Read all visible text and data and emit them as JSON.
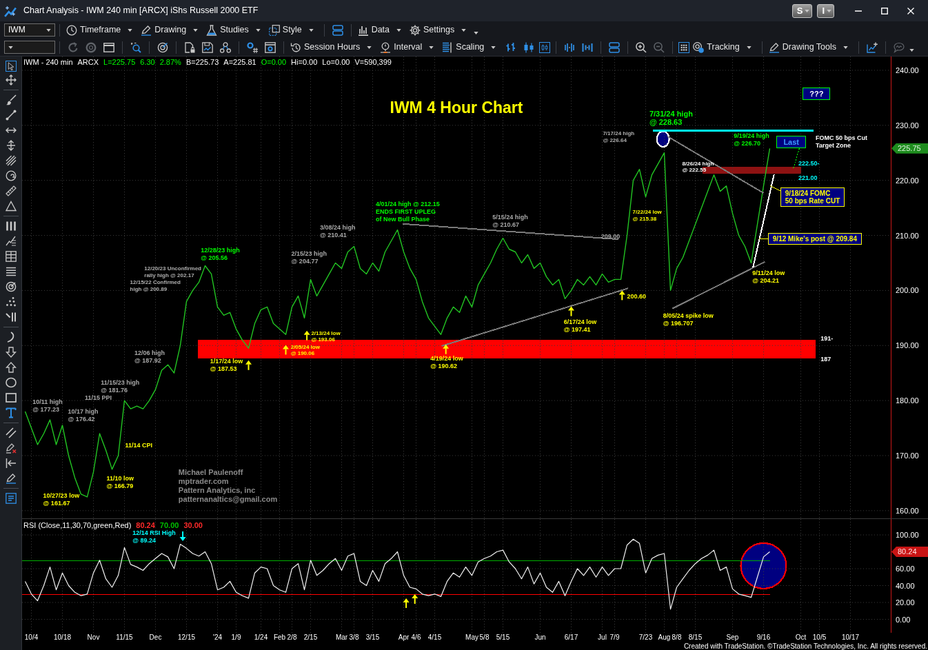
{
  "window": {
    "title": "Chart Analysis - IWM 240 min [ARCX] iShs Russell 2000 ETF",
    "account_buttons": [
      "S",
      "I"
    ]
  },
  "toolbar_1": {
    "symbol": "IWM",
    "menus": [
      "Timeframe",
      "Drawing",
      "Studies",
      "Style",
      "Data",
      "Settings"
    ]
  },
  "toolbar_2": {
    "menus": [
      "Session Hours",
      "Interval",
      "Scaling",
      "Tracking",
      "Drawing Tools"
    ],
    "bar_types": [
      {
        "selected": false
      },
      {
        "selected": false
      },
      {
        "selected": true
      }
    ],
    "grid": {
      "on": true
    }
  },
  "tool_palette": [
    {
      "selected": true
    },
    {
      "selected": false
    },
    {
      "selected": false
    },
    {
      "selected": false
    },
    {
      "selected": false
    },
    {
      "selected": false
    },
    {
      "selected": false
    },
    {
      "selected": false
    },
    {
      "selected": false
    },
    {
      "selected": false
    },
    {
      "selected": false
    },
    {
      "selected": false
    },
    {
      "selected": false
    },
    {
      "selected": false
    },
    {
      "selected": false
    },
    {
      "selected": false
    },
    {
      "selected": false
    },
    {
      "selected": false
    },
    {
      "selected": false
    },
    {
      "selected": false
    },
    {
      "selected": false
    },
    {
      "selected": false
    },
    {
      "selected": false
    },
    {
      "selected": false
    },
    {
      "selected": false
    },
    {
      "selected": false
    },
    {
      "selected": false
    },
    {
      "selected": false
    }
  ],
  "price_panel": {
    "info": [
      {
        "text": "IWM - 240 min",
        "color": "#ffffff"
      },
      {
        "text": "ARCX",
        "color": "#ffffff"
      },
      {
        "text": "L=225.75",
        "color": "#00ff00"
      },
      {
        "text": "6.30",
        "color": "#00ff00"
      },
      {
        "text": "2.87%",
        "color": "#00ff00"
      },
      {
        "text": "B=225.73",
        "color": "#ffffff"
      },
      {
        "text": "A=225.81",
        "color": "#ffffff"
      },
      {
        "text": "O=0.00",
        "color": "#00ff00"
      },
      {
        "text": "Hi=0.00",
        "color": "#ffffff"
      },
      {
        "text": "Lo=0.00",
        "color": "#ffffff"
      },
      {
        "text": "V=590,399",
        "color": "#ffffff"
      }
    ],
    "last_marker": "225.75",
    "chart_data": {
      "type": "line",
      "title": "IWM 4 Hour Chart",
      "grid": true,
      "ylim": [
        158.6,
        242.5
      ],
      "yticks": [
        {
          "value": 160,
          "label": "160.00"
        },
        {
          "value": 170,
          "label": "170.00"
        },
        {
          "value": 180,
          "label": "180.00"
        },
        {
          "value": 190,
          "label": "190.00"
        },
        {
          "value": 200,
          "label": "200.00"
        },
        {
          "value": 210,
          "label": "210.00"
        },
        {
          "value": 220,
          "label": "220.00"
        },
        {
          "value": 230,
          "label": "230.00"
        },
        {
          "value": 240,
          "label": "240.00"
        }
      ],
      "values": [
        178,
        175,
        172,
        174,
        176.5,
        172,
        175.5,
        170,
        166,
        163,
        162.5,
        167,
        174,
        171,
        167.5,
        170,
        180,
        178.5,
        179,
        178.5,
        180,
        182,
        185.5,
        186.5,
        185,
        190,
        198,
        200,
        201.5,
        204.5,
        203,
        197,
        195.5,
        196,
        193,
        191,
        189.5,
        194,
        196.5,
        197,
        194,
        193,
        192,
        197,
        199,
        195,
        202,
        199,
        201,
        203,
        205,
        204,
        207,
        208,
        204,
        203,
        205,
        203.5,
        207,
        209,
        211,
        207,
        204,
        202,
        198,
        195,
        193.5,
        192,
        195,
        197,
        196,
        199,
        197,
        201,
        203,
        205,
        207.5,
        209.5,
        207.5,
        207,
        205,
        206.5,
        204,
        205,
        202.5,
        201,
        202,
        198.5,
        200,
        202,
        201,
        202.5,
        201,
        203,
        201.5,
        202,
        202,
        210,
        220,
        222,
        217,
        221,
        223,
        225,
        200,
        204,
        206,
        209,
        212,
        215,
        218,
        221,
        218,
        219,
        214,
        210,
        208,
        205,
        212,
        219,
        225.8,
        null,
        null,
        null,
        null,
        null,
        null,
        null,
        null,
        null,
        null,
        null,
        null,
        null,
        null,
        null,
        null,
        null,
        null,
        null
      ]
    },
    "drawings": [
      {
        "kind": "band",
        "color": "#ff0000"
      },
      {
        "kind": "band",
        "color": "#8e1212"
      },
      {
        "kind": "thick_line",
        "color": "#00ffff"
      },
      {
        "kind": "ellipse",
        "color": "#ffffff"
      },
      {
        "kind": "line",
        "color": "#7a7a7a"
      },
      {
        "kind": "line",
        "color": "#7a7a7a"
      },
      {
        "kind": "line",
        "color": "#7a7a7a"
      },
      {
        "kind": "line",
        "color": "#7a7a7a"
      },
      {
        "kind": "line",
        "color": "#ffffff"
      },
      {
        "kind": "dotted_line",
        "color": "#00ff00"
      },
      {
        "kind": "leader_line",
        "color": "#ffff00"
      },
      {
        "kind": "leader_line",
        "color": "#ffff00"
      },
      {
        "kind": "up_arrow",
        "color": "#ffff00"
      },
      {
        "kind": "up_arrow",
        "color": "#ffff00"
      },
      {
        "kind": "up_arrow",
        "color": "#ffff00"
      },
      {
        "kind": "up_arrow",
        "color": "#ffff00"
      },
      {
        "kind": "up_arrow",
        "color": "#ffff00"
      },
      {
        "kind": "up_arrow",
        "color": "#ffff00"
      }
    ],
    "notes": [
      {
        "kind": "tag",
        "text": "???",
        "color": "#ffffff"
      },
      {
        "kind": "large_text",
        "text": "7/31/24 high\n@ 228.63",
        "color": "#00ff00"
      },
      {
        "kind": "small_text",
        "text": "7/17/24 high\n@ 226.64",
        "color": "#b0b0b0"
      },
      {
        "kind": "text",
        "text": "9/19/24 high\n@ 226.70",
        "color": "#00ff00"
      },
      {
        "kind": "tag",
        "text": "Last",
        "color": "#3d9bff"
      },
      {
        "kind": "text",
        "text": "FOMC 50 bps Cut\nTarget Zone",
        "color": "#ffffff"
      },
      {
        "kind": "small_text",
        "text": "8/26/24 high\n@ 222.55",
        "color": "#ffffff"
      },
      {
        "kind": "text",
        "text": "222.50-",
        "color": "#00ffff"
      },
      {
        "kind": "text",
        "text": "221.00",
        "color": "#00ffff"
      },
      {
        "kind": "callout",
        "text": "9/18/24 FOMC\n50 bps Rate CUT",
        "color": "#ffff00"
      },
      {
        "kind": "text",
        "text": "4/01/24 high @ 212.15\nENDS FIRST UPLEG\nof New Bull Phase",
        "color": "#00ff00"
      },
      {
        "kind": "small_text",
        "text": "7/22/24 low\n@ 215.38",
        "color": "#ffff00"
      },
      {
        "kind": "text",
        "text": "5/15/24 high\n@ 210.67",
        "color": "#a8a8a8"
      },
      {
        "kind": "text",
        "text": "3/08/24 high\n@ 210.41",
        "color": "#a8a8a8"
      },
      {
        "kind": "text",
        "text": "209.00",
        "color": "#a8a8a8"
      },
      {
        "kind": "callout",
        "text": "9/12 Mike's post @ 209.84",
        "color": "#ffff00"
      },
      {
        "kind": "text",
        "text": "12/28/23 high\n@ 205.56",
        "color": "#00ff00"
      },
      {
        "kind": "text",
        "text": "2/15/23 high\n@ 204.77",
        "color": "#a8a8a8"
      },
      {
        "kind": "small_text",
        "text": "12/20/23 Unconfirmed\nrally high @ 202.17",
        "color": "#b0b0b0"
      },
      {
        "kind": "text",
        "text": "9/11/24 low\n@ 204.21",
        "color": "#ffff00"
      },
      {
        "kind": "small_text",
        "text": "12/15/22 Confirmed\nhigh @ 200.89",
        "color": "#b0b0b0"
      },
      {
        "kind": "text",
        "text": "200.60",
        "color": "#ffff00"
      },
      {
        "kind": "text",
        "text": "8/05/24 spike low\n@ 196.707",
        "color": "#ffff00"
      },
      {
        "kind": "text",
        "text": "6/17/24 low\n@ 197.41",
        "color": "#ffff00"
      },
      {
        "kind": "small_text",
        "text": "2/13/24 low\n@ 193.06",
        "color": "#ffff00"
      },
      {
        "kind": "text",
        "text": "191-",
        "color": "#ffffff"
      },
      {
        "kind": "small_text",
        "text": "2/05/24 low\n@ 190.06",
        "color": "#ffff00"
      },
      {
        "kind": "text",
        "text": "12/06 high\n@ 187.92",
        "color": "#a8a8a8"
      },
      {
        "kind": "text",
        "text": "1/17/24 low\n@ 187.53",
        "color": "#ffff00"
      },
      {
        "kind": "text",
        "text": "4/19/24 low\n@ 190.62",
        "color": "#ffff00"
      },
      {
        "kind": "text",
        "text": "187",
        "color": "#ffffff"
      },
      {
        "kind": "text",
        "text": "11/15/23 high\n@ 181.76",
        "color": "#a8a8a8"
      },
      {
        "kind": "text",
        "text": "11/15 PPI",
        "color": "#a8a8a8"
      },
      {
        "kind": "text",
        "text": "10/11 high\n@ 177.23",
        "color": "#a8a8a8"
      },
      {
        "kind": "text",
        "text": "10/17 high\n@ 176.42",
        "color": "#a8a8a8"
      },
      {
        "kind": "text",
        "text": "11/14 CPI",
        "color": "#ffff00"
      },
      {
        "kind": "large_text",
        "text": "Michael Paulenoff\nmptrader.com\nPattern Analytics, inc\npatternanaltics@gmail.com",
        "color": "#8a8a8a"
      },
      {
        "kind": "text",
        "text": "11/10 low\n@ 166.79",
        "color": "#ffff00"
      },
      {
        "kind": "text",
        "text": "10/27/23 low\n@ 161.67",
        "color": "#ffff00"
      }
    ]
  },
  "rsi_panel": {
    "legend": [
      {
        "text": "RSI (Close,11,30,70,green,Red)",
        "color": "#ffffff"
      },
      {
        "text": "80.24",
        "color": "#ff2a2a"
      },
      {
        "text": "70.00",
        "color": "#00c000"
      },
      {
        "text": "30.00",
        "color": "#ff2a2a"
      }
    ],
    "last_marker": "80.24",
    "chart_data": {
      "type": "line",
      "grid": true,
      "ylim": [
        -15.9,
        118.8
      ],
      "categories": [
        null,
        "10/4",
        null,
        null,
        null,
        null,
        "10/18",
        null,
        null,
        null,
        null,
        "Nov",
        null,
        null,
        null,
        null,
        "11/15",
        null,
        null,
        null,
        null,
        "Dec",
        null,
        null,
        null,
        null,
        "12/15",
        null,
        null,
        null,
        null,
        "'24",
        null,
        null,
        "1/9",
        null,
        null,
        null,
        "1/24",
        null,
        null,
        "Feb",
        null,
        "2/8",
        null,
        null,
        "2/15",
        null,
        null,
        null,
        null,
        "Mar",
        null,
        "3/8",
        null,
        null,
        "3/15",
        null,
        null,
        null,
        null,
        "Apr",
        null,
        "4/6",
        null,
        null,
        "4/15",
        null,
        null,
        null,
        null,
        null,
        "May",
        null,
        "5/8",
        null,
        null,
        "5/15",
        null,
        null,
        null,
        null,
        null,
        "Jun",
        null,
        null,
        null,
        null,
        "6/17",
        null,
        null,
        null,
        null,
        "Jul",
        null,
        "7/9",
        null,
        null,
        null,
        null,
        "7/23",
        null,
        null,
        "Aug",
        null,
        "8/8",
        null,
        null,
        "8/15",
        null,
        null,
        null,
        null,
        null,
        "Sep",
        null,
        null,
        null,
        null,
        "9/16",
        null,
        null,
        null,
        null,
        null,
        "Oct",
        null,
        null,
        "10/5",
        null,
        null,
        null,
        null,
        "10/17",
        null,
        null,
        null,
        null,
        null,
        null
      ],
      "yticks": [
        {
          "value": 0,
          "label": "0.00"
        },
        {
          "value": 20,
          "label": "20.00"
        },
        {
          "value": 40,
          "label": "40.00"
        },
        {
          "value": 60,
          "label": "60.00"
        },
        {
          "value": 100,
          "label": "100.00"
        }
      ],
      "ref_lines": [
        {
          "axis": "y",
          "value": 70,
          "color": "#00b000"
        },
        {
          "axis": "y",
          "value": 30,
          "color": "#ff0000"
        }
      ],
      "values": [
        45,
        30,
        22,
        40,
        62,
        35,
        55,
        40,
        32,
        28,
        30,
        55,
        70,
        48,
        38,
        52,
        85,
        65,
        62,
        58,
        66,
        72,
        78,
        74,
        60,
        89,
        84,
        78,
        75,
        80,
        66,
        35,
        38,
        45,
        32,
        28,
        25,
        55,
        62,
        60,
        40,
        35,
        32,
        60,
        66,
        35,
        70,
        52,
        58,
        66,
        72,
        58,
        75,
        78,
        45,
        40,
        58,
        45,
        66,
        72,
        80,
        52,
        38,
        36,
        30,
        28,
        30,
        27,
        45,
        55,
        50,
        62,
        52,
        68,
        72,
        75,
        80,
        82,
        68,
        60,
        48,
        62,
        42,
        55,
        38,
        32,
        45,
        28,
        45,
        60,
        52,
        62,
        50,
        62,
        52,
        60,
        60,
        88,
        95,
        90,
        55,
        72,
        76,
        78,
        12,
        38,
        48,
        58,
        66,
        72,
        76,
        82,
        58,
        62,
        36,
        30,
        28,
        26,
        50,
        74,
        80,
        null,
        null,
        null,
        null,
        null,
        null,
        null,
        null,
        null,
        null,
        null,
        null,
        null,
        null,
        null,
        null,
        null,
        null,
        null
      ]
    },
    "drawings": [
      {
        "kind": "ellipse",
        "color": "#ff0000"
      },
      {
        "kind": "down_arrow",
        "color": "#00ffff"
      },
      {
        "kind": "up_arrow",
        "color": "#ffff00"
      },
      {
        "kind": "up_arrow",
        "color": "#ffff00"
      }
    ],
    "notes": [
      {
        "kind": "text",
        "text": "12/14 RSI High\n@ 89.24",
        "color": "#00ffff"
      }
    ]
  },
  "footer": "Created with TradeStation. ©TradeStation Technologies, Inc. All rights reserved."
}
